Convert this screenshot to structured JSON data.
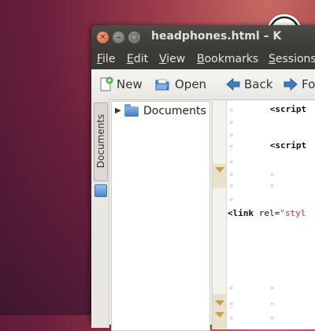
{
  "window": {
    "title": "headphones.html – K",
    "buttons": [
      "close",
      "minimize",
      "maximize"
    ]
  },
  "menubar": {
    "items": [
      {
        "label": "File",
        "underline": "F",
        "rest": "ile"
      },
      {
        "label": "Edit",
        "underline": "E",
        "rest": "dit"
      },
      {
        "label": "View",
        "underline": "V",
        "rest": "iew"
      },
      {
        "label": "Bookmarks",
        "underline": "B",
        "rest": "ookmarks"
      },
      {
        "label": "Sessions",
        "underline": "S",
        "rest": "essions"
      }
    ]
  },
  "toolbar": {
    "new_label": "New",
    "open_label": "Open",
    "back_label": "Back",
    "forward_label": "Fo"
  },
  "side_tab": {
    "label": "Documents"
  },
  "filetree": {
    "items": [
      {
        "label": "Documents",
        "icon": "folder-icon"
      }
    ]
  },
  "editor": {
    "lines": [
      {
        "tag": "<script"
      },
      {
        "tag": "<script"
      },
      {
        "tag": "<link",
        "attr": "rel=",
        "value": "\"styl"
      }
    ]
  },
  "colors": {
    "titlebar": "#3b3a36",
    "close_button": "#e0582b",
    "string": "#c0302a"
  }
}
